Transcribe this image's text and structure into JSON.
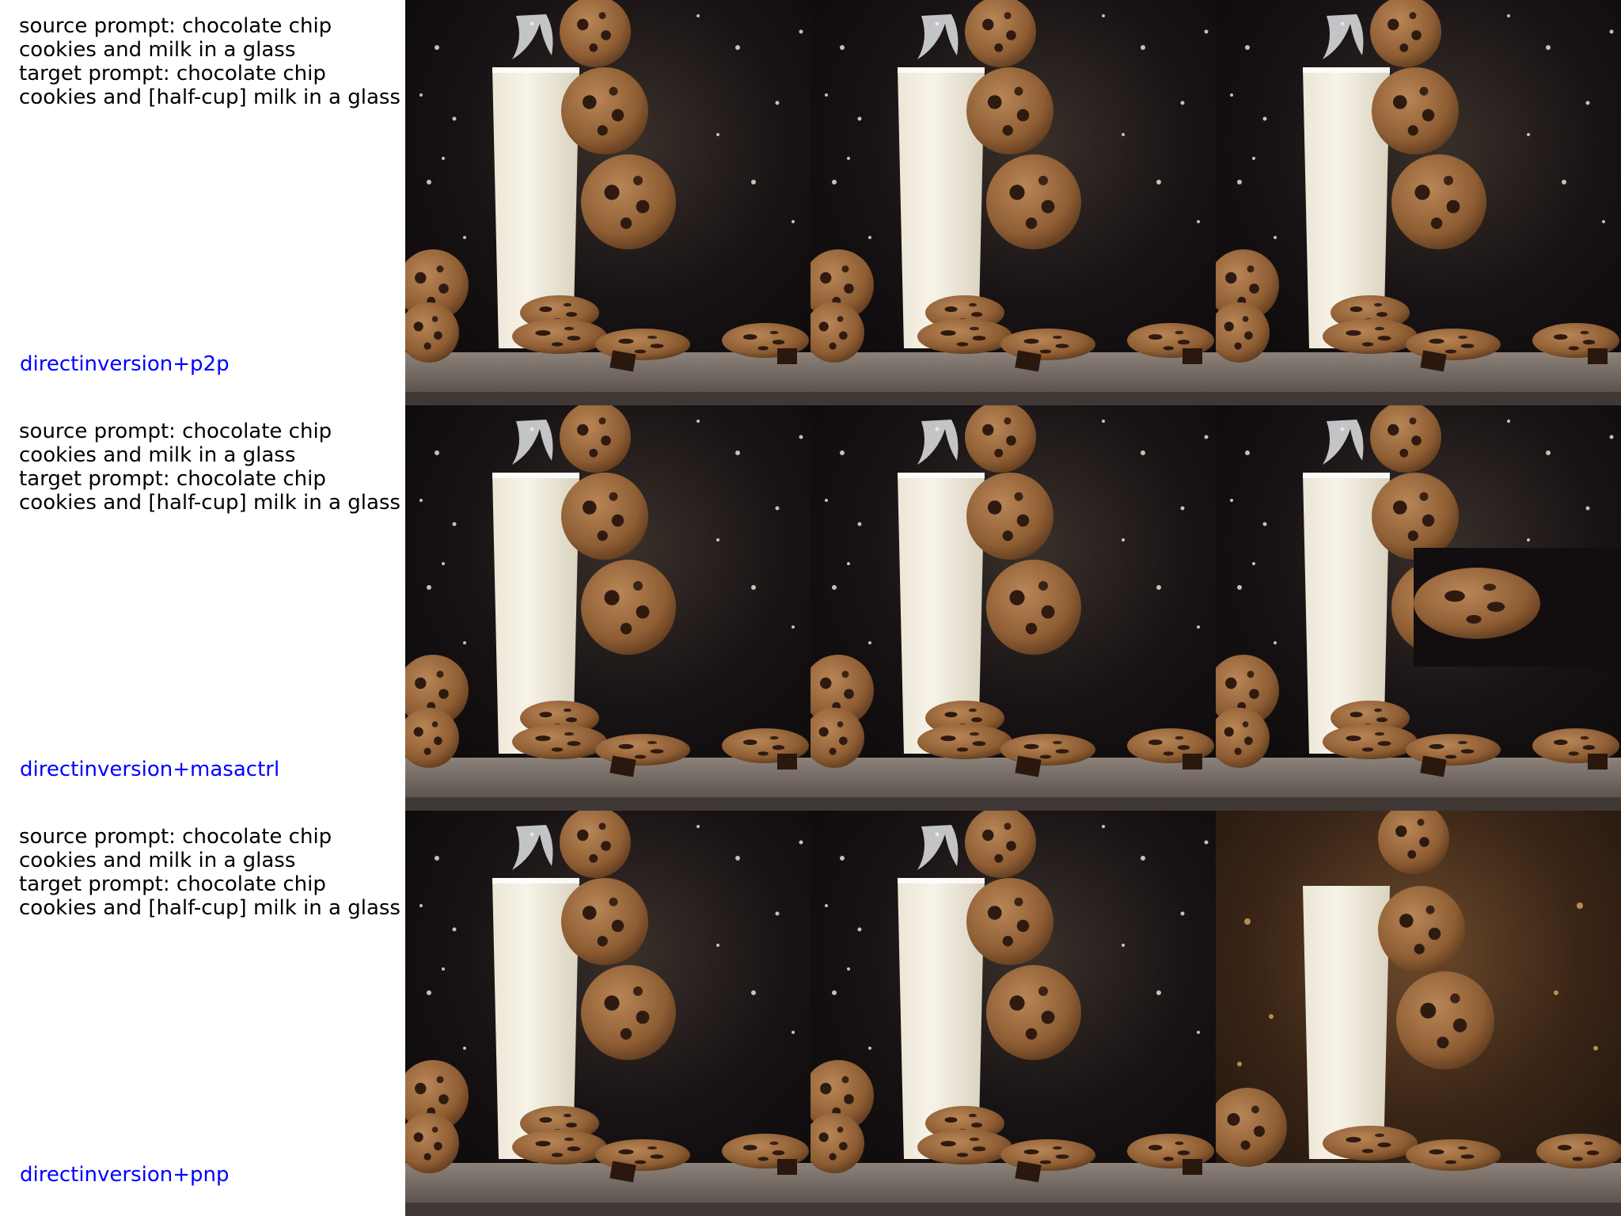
{
  "rows": [
    {
      "source_prompt": "source prompt: chocolate chip cookies and milk in a glass",
      "target_prompt": "target prompt: chocolate chip cookies and [half-cup] milk in a glass",
      "method": "directinversion+p2p",
      "images": [
        {
          "role": "source",
          "glass_fill": 1.0
        },
        {
          "role": "inverted",
          "glass_fill": 1.0
        },
        {
          "role": "edited",
          "glass_fill": 1.0
        }
      ]
    },
    {
      "source_prompt": "source prompt: chocolate chip cookies and milk in a glass",
      "target_prompt": "target prompt: chocolate chip cookies and [half-cup] milk in a glass",
      "method": "directinversion+masactrl",
      "images": [
        {
          "role": "source",
          "glass_fill": 1.0
        },
        {
          "role": "inverted",
          "glass_fill": 1.0
        },
        {
          "role": "edited",
          "glass_fill": 1.0
        }
      ]
    },
    {
      "source_prompt": "source prompt: chocolate chip cookies and milk in a glass",
      "target_prompt": "target prompt: chocolate chip cookies and [half-cup] milk in a glass",
      "method": "directinversion+pnp",
      "images": [
        {
          "role": "source",
          "glass_fill": 1.0
        },
        {
          "role": "inverted",
          "glass_fill": 1.0
        },
        {
          "role": "edited",
          "glass_fill": 1.0
        }
      ]
    }
  ],
  "colors": {
    "background": "#0d0b0c",
    "milk": "#f2ede0",
    "cookie": "#9a6a3c",
    "chip": "#2f1a10",
    "table": "#6d625c",
    "method_label": "#0000ff"
  }
}
